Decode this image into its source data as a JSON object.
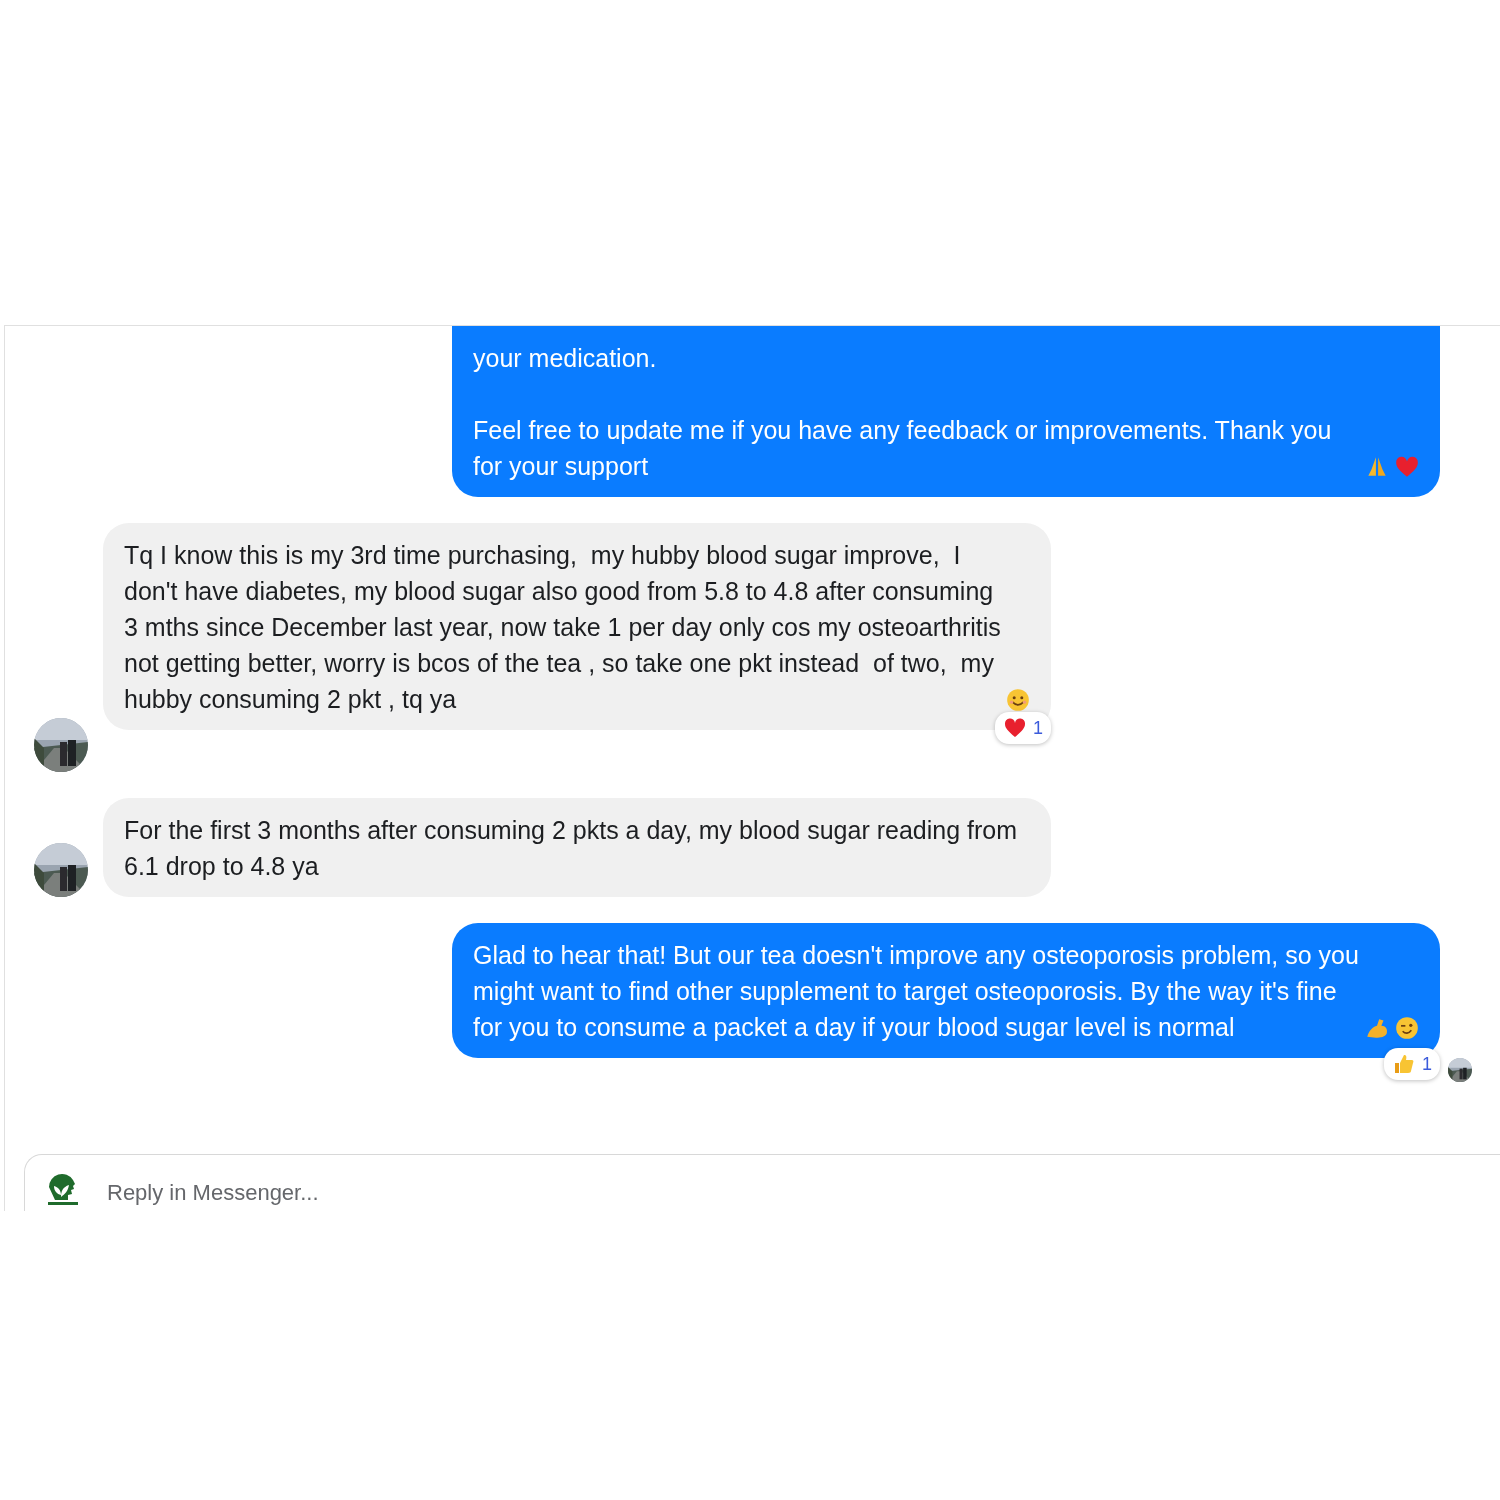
{
  "messages": [
    {
      "kind": "sent",
      "paragraphs": [
        "your medication.",
        "Feel free to update me if you have any feedback or improvements. Thank you for your support"
      ],
      "trailing_icons": [
        {
          "kind": "pray"
        },
        {
          "kind": "heart"
        }
      ]
    },
    {
      "kind": "received",
      "paragraphs": [
        "Tq I know this is my 3rd time purchasing,  my hubby blood sugar improve,  I don't have diabetes, my blood sugar also good from 5.8 to 4.8 after consuming 3 mths since December last year, now take 1 per day only cos my osteoarthritis not getting better, worry is bcos of the tea , so take one pkt instead  of two,  my hubby consuming 2 pkt , tq ya"
      ],
      "trailing_icons": [
        {
          "kind": "smile"
        }
      ],
      "reaction": {
        "kind": "heart",
        "count": "1"
      },
      "avatar": true
    },
    {
      "kind": "received",
      "paragraphs": [
        "For the first 3 months after consuming 2 pkts a day, my blood sugar reading from 6.1 drop to 4.8 ya"
      ],
      "avatar": true
    },
    {
      "kind": "sent",
      "paragraphs": [
        "Glad to hear that! But our tea doesn't improve any osteoporosis problem, so you might want to find other supplement to target osteoporosis. By the way it's fine for you to consume a packet a day if your blood sugar level is normal"
      ],
      "trailing_icons": [
        {
          "kind": "muscle"
        },
        {
          "kind": "wink"
        }
      ],
      "reaction": {
        "kind": "thumbs",
        "count": "1"
      },
      "read_receipt": true
    }
  ],
  "composer": {
    "placeholder": "Reply in Messenger..."
  }
}
